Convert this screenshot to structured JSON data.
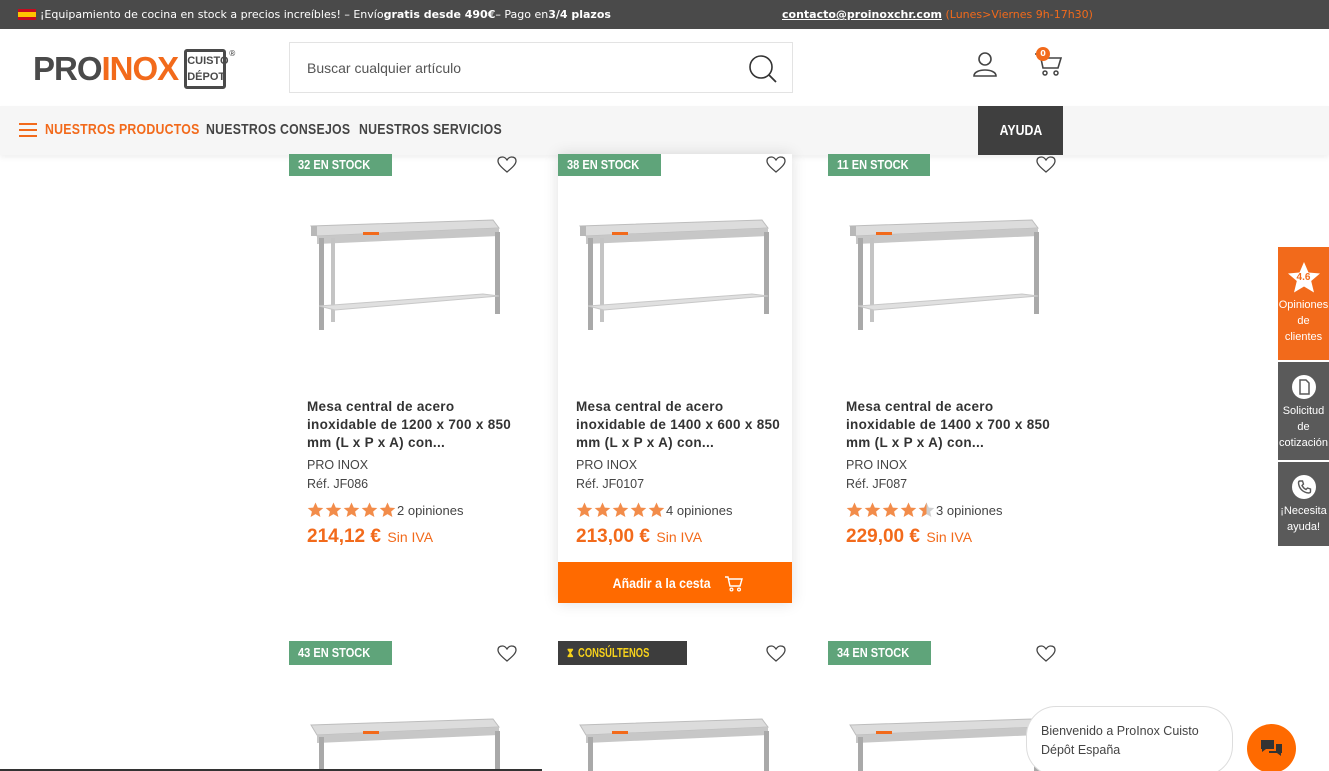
{
  "topbar": {
    "promo_pre": "¡Equipamiento de cocina en stock a precios increíbles! – Envío ",
    "promo_bold1": "gratis desde 490€",
    "promo_mid": " – Pago en ",
    "promo_bold2": "3/4 plazos",
    "email": "contacto@proinoxchr.com",
    "hours": "(Lunes>Viernes 9h-17h30)"
  },
  "header": {
    "logo_pro": "PRO",
    "logo_inox": "INOX",
    "logo_badge_line1": "CUISTO",
    "logo_badge_line2": "DÉPOT",
    "logo_reg": "®",
    "search_placeholder": "Buscar cualquier artículo",
    "cart_count": "0"
  },
  "nav": {
    "products": "NUESTROS PRODUCTOS",
    "advice": "NUESTROS CONSEJOS",
    "services": "NUESTROS SERVICIOS",
    "help": "AYUDA"
  },
  "products": [
    {
      "stock": "32 EN STOCK",
      "title": "Mesa central de acero inoxidable de 1200 x 700 x 850 mm (L x P x A) con...",
      "brand": "PRO INOX",
      "ref": "Réf. JF086",
      "rating": 5,
      "reviews": "2 opiniones",
      "price": "214,12 €",
      "tax": "Sin IVA"
    },
    {
      "stock": "38 EN STOCK",
      "title": "Mesa central de acero inoxidable de 1400 x 600 x 850 mm (L x P x A) con...",
      "brand": "PRO INOX",
      "ref": "Réf. JF0107",
      "rating": 5,
      "reviews": "4 opiniones",
      "price": "213,00 €",
      "tax": "Sin IVA",
      "add_to_cart": "Añadir a la cesta"
    },
    {
      "stock": "11 EN STOCK",
      "title": "Mesa central de acero inoxidable de 1400 x 700 x 850 mm (L x P x A) con...",
      "brand": "PRO INOX",
      "ref": "Réf. JF087",
      "rating": 4.5,
      "reviews": "3 opiniones",
      "price": "229,00 €",
      "tax": "Sin IVA"
    },
    {
      "stock": "43 EN STOCK"
    },
    {
      "stock": "CONSÚLTENOS"
    },
    {
      "stock": "34 EN STOCK"
    }
  ],
  "side": {
    "rating_value": "4.6",
    "reviews_line1": "Opiniones",
    "reviews_line2": "de",
    "reviews_line3": "clientes",
    "quote_line1": "Solicitud",
    "quote_line2": "de",
    "quote_line3": "cotización",
    "help_line1": "¡Necesita",
    "help_line2": "ayuda!"
  },
  "chat": {
    "line1": "Bienvenido a ProInox Cuisto",
    "line2": "Dépôt España"
  },
  "colors": {
    "accent": "#f26a1b",
    "stock_green": "#5fa47a",
    "dark": "#4a4a4a"
  }
}
